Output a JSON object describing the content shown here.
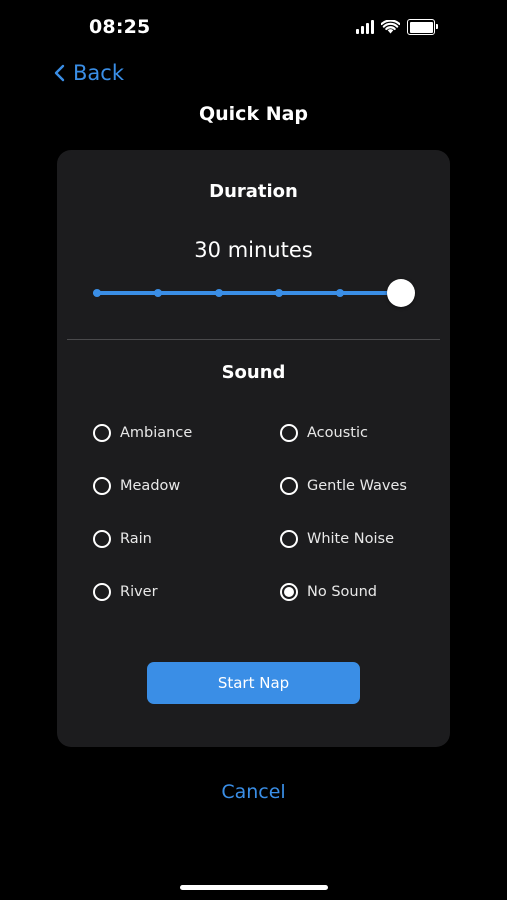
{
  "status_bar": {
    "time": "08:25",
    "icons": [
      "cellular-signal-icon",
      "wifi-icon",
      "battery-icon"
    ]
  },
  "nav": {
    "back_label": "Back",
    "title": "Quick Nap"
  },
  "duration": {
    "title": "Duration",
    "value_label": "30 minutes",
    "slider": {
      "step_count": 6,
      "selected_step": 6,
      "fraction": 1.0
    }
  },
  "sound": {
    "title": "Sound",
    "options": [
      {
        "label": "Ambiance",
        "selected": false
      },
      {
        "label": "Acoustic",
        "selected": false
      },
      {
        "label": "Meadow",
        "selected": false
      },
      {
        "label": "Gentle Waves",
        "selected": false
      },
      {
        "label": "Rain",
        "selected": false
      },
      {
        "label": "White Noise",
        "selected": false
      },
      {
        "label": "River",
        "selected": false
      },
      {
        "label": "No Sound",
        "selected": true
      }
    ]
  },
  "actions": {
    "start_label": "Start Nap",
    "cancel_label": "Cancel"
  },
  "colors": {
    "background": "#000000",
    "card": "#1c1c1e",
    "accent": "#3a8ee6",
    "text": "#ffffff"
  }
}
